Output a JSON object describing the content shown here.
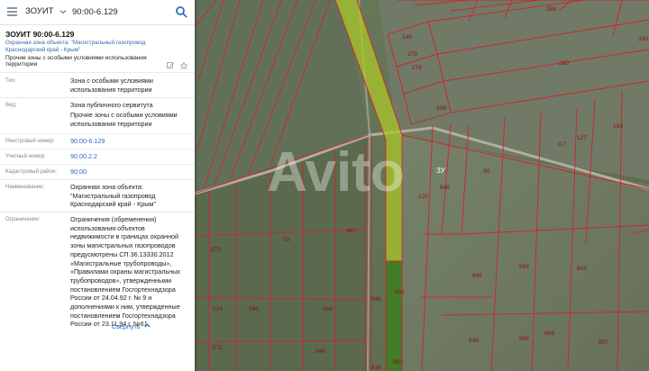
{
  "search": {
    "layer": "ЗОУИТ",
    "query": "90:00-6.129"
  },
  "card": {
    "title": "ЗОУИТ 90:00-6.129",
    "subtitle": "Охранная зона объекта: \"Магистральный газопровод Краснодарский край - Крым\"",
    "category": "Прочие зоны с особыми условиями использования территории",
    "collapse_label": "Свернуть"
  },
  "fields": {
    "type": {
      "label": "Тип:",
      "value": "Зона с особыми условиями использования территории"
    },
    "kind": {
      "label": "Вид:",
      "value1": "Зона публичного сервитута",
      "value2": "Прочие зоны с особыми условиями использования территории"
    },
    "registry": {
      "label": "Реестровый номер:",
      "value": "90:00-6.129"
    },
    "account": {
      "label": "Учетный номер:",
      "value": "90.00.2.2"
    },
    "district": {
      "label": "Кадастровый район:",
      "value": "90:00"
    },
    "name": {
      "label": "Наименование:",
      "value": "Охранная зона объекта: \"Магистральный газопровод Краснодарский край - Крым\""
    },
    "restriction": {
      "label": "Ограничение:",
      "value": "Ограничения (обременения) использования объектов недвижимости в границах охранной зоны магистральных газопроводов предусмотрены СП 36.13330.2012 «Магистральные трубопроводы», «Правилами охраны магистральных трубопроводов», утвержденными постановлением Госгортехнадзора России от 24.04.92 г. № 9 и дополнениями к ним, утвержденные постановлением Госгортехнадзора России от 23.11.94 г. №61"
    }
  },
  "map": {
    "plot_labels": {
      "p149": "149",
      "p279": "279",
      "p276": "276",
      "p280": "280",
      "p308": "308",
      "p269": "269",
      "p330": "330",
      "p117": "117",
      "p127": "127",
      "p193": "193",
      "p848": "848",
      "p120": "120",
      "p90": "90",
      "p872": "872",
      "p59": "59",
      "p487": "487",
      "p845": "845",
      "p863": "863",
      "p843": "843",
      "p841": "841",
      "p846": "846",
      "p574": "574",
      "p566": "566",
      "p564": "564",
      "p875": "875",
      "p848b": "848",
      "p869": "869",
      "p858": "858",
      "p836": "836",
      "p850": "850",
      "p849": "849",
      "p857": "857"
    },
    "zu_label": "ЗУ",
    "watermark": "Avito"
  }
}
